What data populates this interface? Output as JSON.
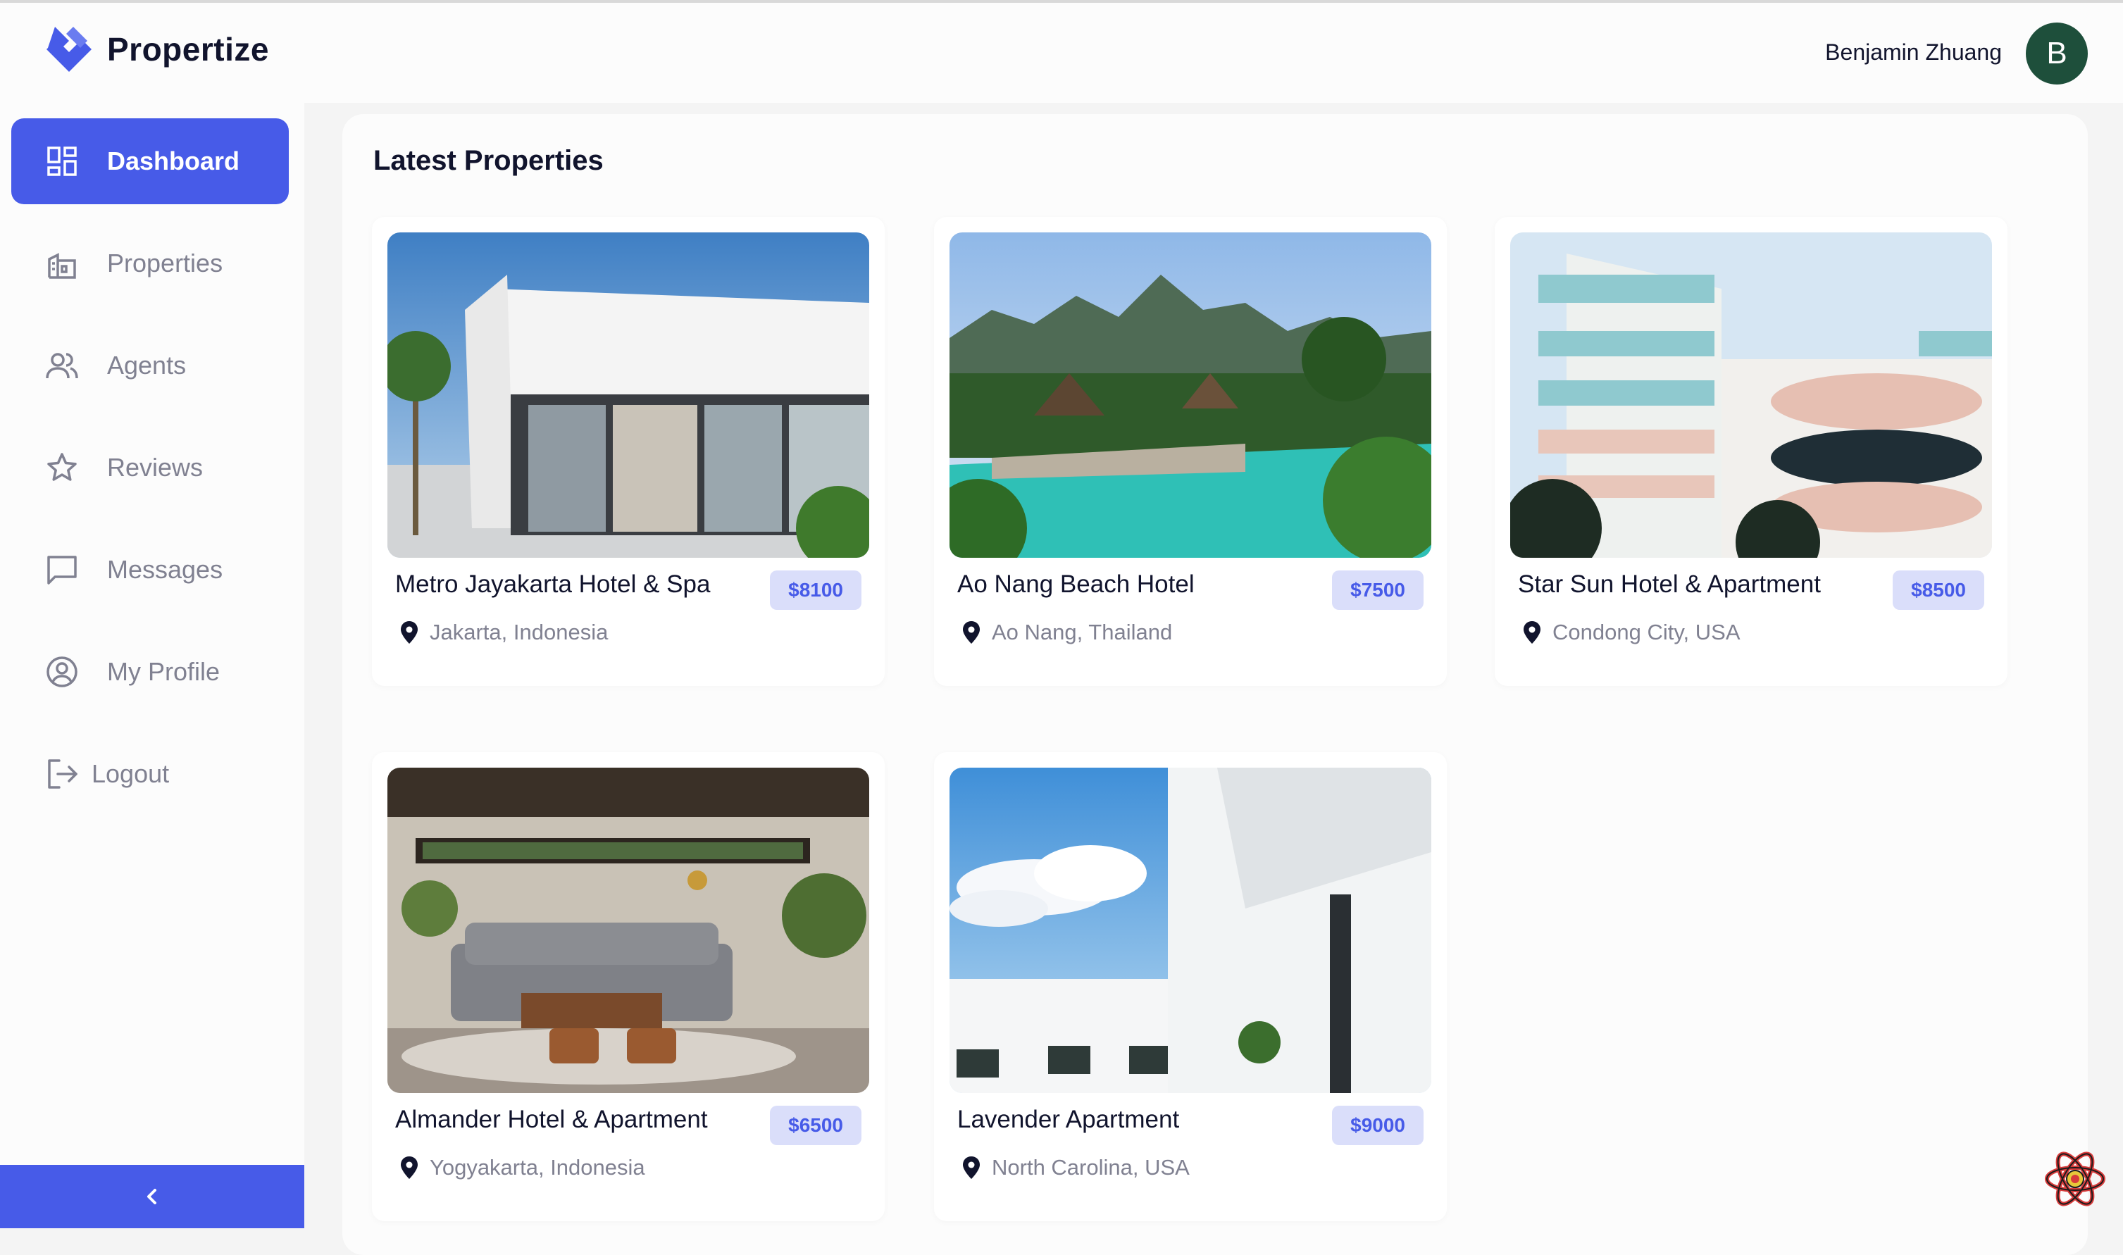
{
  "app": {
    "name": "Propertize"
  },
  "user": {
    "name": "Benjamin Zhuang",
    "initial": "B"
  },
  "sidebar": {
    "items": [
      {
        "label": "Dashboard",
        "icon": "dashboard-icon",
        "active": true
      },
      {
        "label": "Properties",
        "icon": "building-icon"
      },
      {
        "label": "Agents",
        "icon": "people-icon"
      },
      {
        "label": "Reviews",
        "icon": "star-icon"
      },
      {
        "label": "Messages",
        "icon": "chat-icon"
      },
      {
        "label": "My Profile",
        "icon": "profile-icon"
      }
    ],
    "logout_label": "Logout",
    "collapse_icon": "chevron-left-icon"
  },
  "main": {
    "title": "Latest Properties",
    "properties": [
      {
        "name": "Metro Jayakarta Hotel & Spa",
        "price": "$8100",
        "location": "Jakarta, Indonesia"
      },
      {
        "name": "Ao Nang Beach Hotel",
        "price": "$7500",
        "location": "Ao Nang, Thailand"
      },
      {
        "name": "Star Sun Hotel & Apartment",
        "price": "$8500",
        "location": "Condong City, USA"
      },
      {
        "name": "Almander Hotel & Apartment",
        "price": "$6500",
        "location": "Yogyakarta, Indonesia"
      },
      {
        "name": "Lavender Apartment",
        "price": "$9000",
        "location": "North Carolina, USA"
      }
    ]
  },
  "colors": {
    "accent": "#475be8",
    "accent_light": "#dadefa",
    "text_primary": "#11142d",
    "text_secondary": "#808191",
    "avatar_bg": "#1e4f3b"
  }
}
